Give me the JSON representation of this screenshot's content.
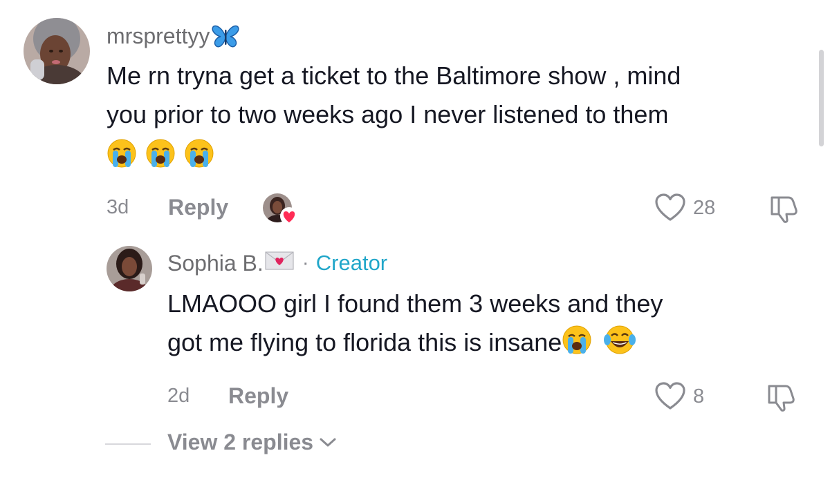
{
  "comment": {
    "username": "mrsprettyy",
    "username_badge_icon": "blue-butterfly-icon",
    "text_line1": "Me rn tryna get a ticket to the Baltimore show , mind",
    "text_line2": "you prior to two weeks ago I never listened to them",
    "emojis": [
      "loudly-crying-face",
      "loudly-crying-face",
      "loudly-crying-face"
    ],
    "time": "3d",
    "reply_label": "Reply",
    "like_count": "28"
  },
  "reply": {
    "username": "Sophia B.",
    "username_badge_icon": "love-letter-icon",
    "separator": "·",
    "creator_label": "Creator",
    "text_line1": "LMAOOO girl I found them 3 weeks and they",
    "text_line2": "got me flying to florida this is insane",
    "trailing_emojis": [
      "loudly-crying-face",
      "tears-of-joy-face"
    ],
    "time": "2d",
    "reply_label": "Reply",
    "like_count": "8"
  },
  "view_replies": {
    "label": "View 2 replies"
  },
  "colors": {
    "text": "#161823",
    "muted": "#8a8b91",
    "creator": "#20a6c9",
    "heart": "#ff2c55"
  }
}
